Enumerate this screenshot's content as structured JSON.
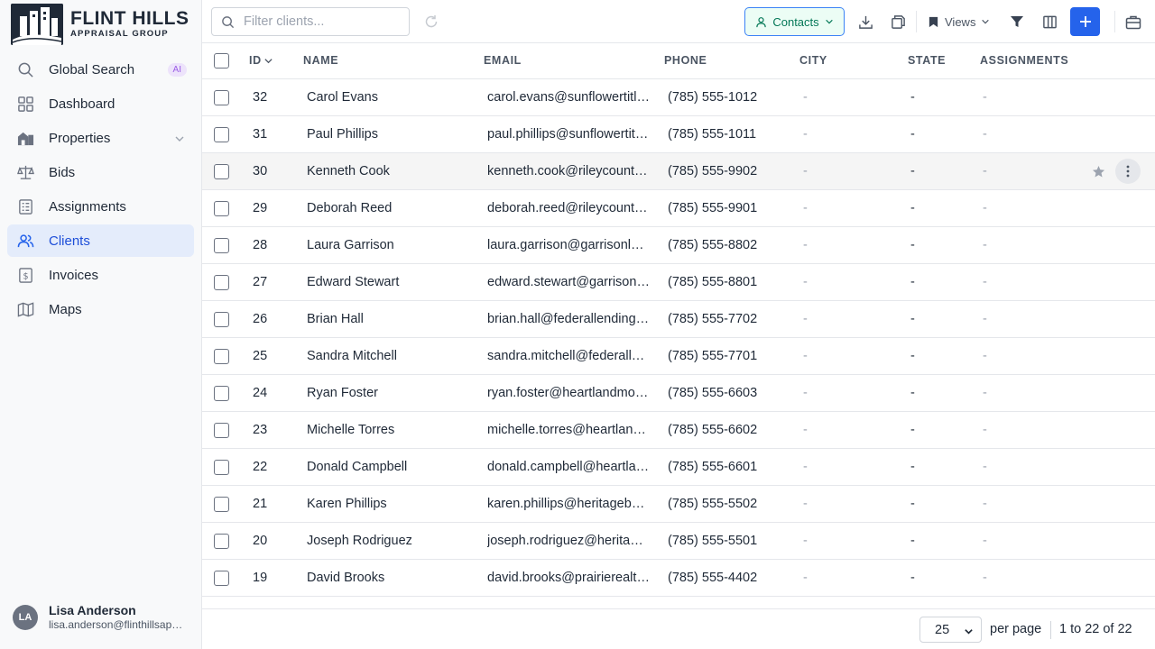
{
  "brand": {
    "title": "FLINT HILLS",
    "subtitle": "APPRAISAL GROUP"
  },
  "sidebar": {
    "items": [
      {
        "label": "Global Search",
        "icon": "search-icon",
        "badge": "AI"
      },
      {
        "label": "Dashboard",
        "icon": "dashboard-icon"
      },
      {
        "label": "Properties",
        "icon": "properties-icon"
      },
      {
        "label": "Bids",
        "icon": "scale-icon"
      },
      {
        "label": "Assignments",
        "icon": "clipboard-icon"
      },
      {
        "label": "Clients",
        "icon": "users-icon",
        "active": true
      },
      {
        "label": "Invoices",
        "icon": "invoice-icon"
      },
      {
        "label": "Maps",
        "icon": "map-icon"
      }
    ],
    "user": {
      "initials": "LA",
      "name": "Lisa Anderson",
      "email": "lisa.anderson@flinthillsappraisal.com"
    }
  },
  "toolbar": {
    "search_placeholder": "Filter clients...",
    "contacts_label": "Contacts",
    "views_label": "Views"
  },
  "table": {
    "headers": {
      "id": "ID",
      "name": "NAME",
      "email": "EMAIL",
      "phone": "PHONE",
      "city": "CITY",
      "state": "STATE",
      "assignments": "ASSIGNMENTS"
    },
    "rows": [
      {
        "id": "32",
        "name": "Carol Evans",
        "email": "carol.evans@sunflowertitle.com",
        "phone": "(785) 555-1012",
        "city": "-",
        "state": "-",
        "assignments": "-"
      },
      {
        "id": "31",
        "name": "Paul Phillips",
        "email": "paul.phillips@sunflowertitle.com",
        "phone": "(785) 555-1011",
        "city": "-",
        "state": "-",
        "assignments": "-"
      },
      {
        "id": "30",
        "name": "Kenneth Cook",
        "email": "kenneth.cook@rileycountybank.com",
        "phone": "(785) 555-9902",
        "city": "-",
        "state": "-",
        "assignments": "-"
      },
      {
        "id": "29",
        "name": "Deborah Reed",
        "email": "deborah.reed@rileycountybank.com",
        "phone": "(785) 555-9901",
        "city": "-",
        "state": "-",
        "assignments": "-"
      },
      {
        "id": "28",
        "name": "Laura Garrison",
        "email": "laura.garrison@garrisonlaw.com",
        "phone": "(785) 555-8802",
        "city": "-",
        "state": "-",
        "assignments": "-"
      },
      {
        "id": "27",
        "name": "Edward Stewart",
        "email": "edward.stewart@garrisonlaw.com",
        "phone": "(785) 555-8801",
        "city": "-",
        "state": "-",
        "assignments": "-"
      },
      {
        "id": "26",
        "name": "Brian Hall",
        "email": "brian.hall@federallending.com",
        "phone": "(785) 555-7702",
        "city": "-",
        "state": "-",
        "assignments": "-"
      },
      {
        "id": "25",
        "name": "Sandra Mitchell",
        "email": "sandra.mitchell@federallending.com",
        "phone": "(785) 555-7701",
        "city": "-",
        "state": "-",
        "assignments": "-"
      },
      {
        "id": "24",
        "name": "Ryan Foster",
        "email": "ryan.foster@heartlandmortgage.com",
        "phone": "(785) 555-6603",
        "city": "-",
        "state": "-",
        "assignments": "-"
      },
      {
        "id": "23",
        "name": "Michelle Torres",
        "email": "michelle.torres@heartlandmortgage.com",
        "phone": "(785) 555-6602",
        "city": "-",
        "state": "-",
        "assignments": "-"
      },
      {
        "id": "22",
        "name": "Donald Campbell",
        "email": "donald.campbell@heartlandmortgage.com",
        "phone": "(785) 555-6601",
        "city": "-",
        "state": "-",
        "assignments": "-"
      },
      {
        "id": "21",
        "name": "Karen Phillips",
        "email": "karen.phillips@heritagebank.com",
        "phone": "(785) 555-5502",
        "city": "-",
        "state": "-",
        "assignments": "-"
      },
      {
        "id": "20",
        "name": "Joseph Rodriguez",
        "email": "joseph.rodriguez@heritagebank.com",
        "phone": "(785) 555-5501",
        "city": "-",
        "state": "-",
        "assignments": "-"
      },
      {
        "id": "19",
        "name": "David Brooks",
        "email": "david.brooks@prairierealty.com",
        "phone": "(785) 555-4402",
        "city": "-",
        "state": "-",
        "assignments": "-"
      }
    ]
  },
  "footer": {
    "page_size": "25",
    "per_page_label": "per page",
    "range_label": "1 to 22 of 22"
  },
  "colors": {
    "accent": "#2563eb",
    "active_bg": "#e4ecfb",
    "contacts_text": "#047857",
    "ai_badge": "#9b5de5"
  }
}
